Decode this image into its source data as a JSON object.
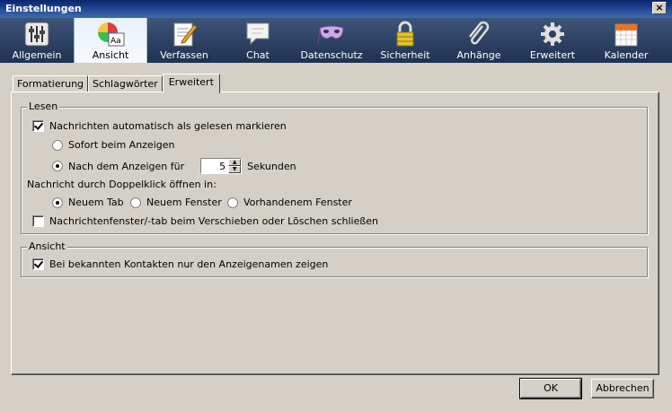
{
  "window": {
    "title": "Einstellungen",
    "close": "×"
  },
  "toolbar": {
    "items": [
      {
        "label": "Allgemein",
        "icon": "sliders-icon"
      },
      {
        "label": "Ansicht",
        "icon": "color-text-icon"
      },
      {
        "label": "Verfassen",
        "icon": "pencil-paper-icon"
      },
      {
        "label": "Chat",
        "icon": "speech-bubble-icon"
      },
      {
        "label": "Datenschutz",
        "icon": "mask-icon"
      },
      {
        "label": "Sicherheit",
        "icon": "lock-icon"
      },
      {
        "label": "Anhänge",
        "icon": "paperclip-icon"
      },
      {
        "label": "Erweitert",
        "icon": "gear-icon"
      },
      {
        "label": "Kalender",
        "icon": "calendar-icon"
      }
    ],
    "active": "Ansicht"
  },
  "tabs": [
    "Formatierung",
    "Schlagwörter",
    "Erweitert"
  ],
  "active_tab": "Erweitert",
  "lesen": {
    "legend": "Lesen",
    "mark_read": {
      "label": "Nachrichten automatisch als gelesen markieren",
      "checked": true
    },
    "sofort": {
      "label": "Sofort beim Anzeigen",
      "selected": false
    },
    "nach": {
      "label_prefix": "Nach dem Anzeigen für",
      "value": "5",
      "suffix": "Sekunden",
      "selected": true
    },
    "doubleclick_label": "Nachricht durch Doppelklick öffnen in:",
    "neuer_tab": {
      "label": "Neuem Tab",
      "selected": true
    },
    "neues_fenster": {
      "label": "Neuem Fenster",
      "selected": false
    },
    "vorhandenes_fenster": {
      "label": "Vorhandenem Fenster",
      "selected": false
    },
    "close_on_move": {
      "label": "Nachrichtenfenster/-tab beim Verschieben oder Löschen schließen",
      "checked": false
    }
  },
  "ansicht": {
    "legend": "Ansicht",
    "display_names": {
      "label": "Bei bekannten Kontakten nur den Anzeigenamen zeigen",
      "checked": true
    }
  },
  "buttons": {
    "ok": "OK",
    "cancel": "Abbrechen"
  }
}
